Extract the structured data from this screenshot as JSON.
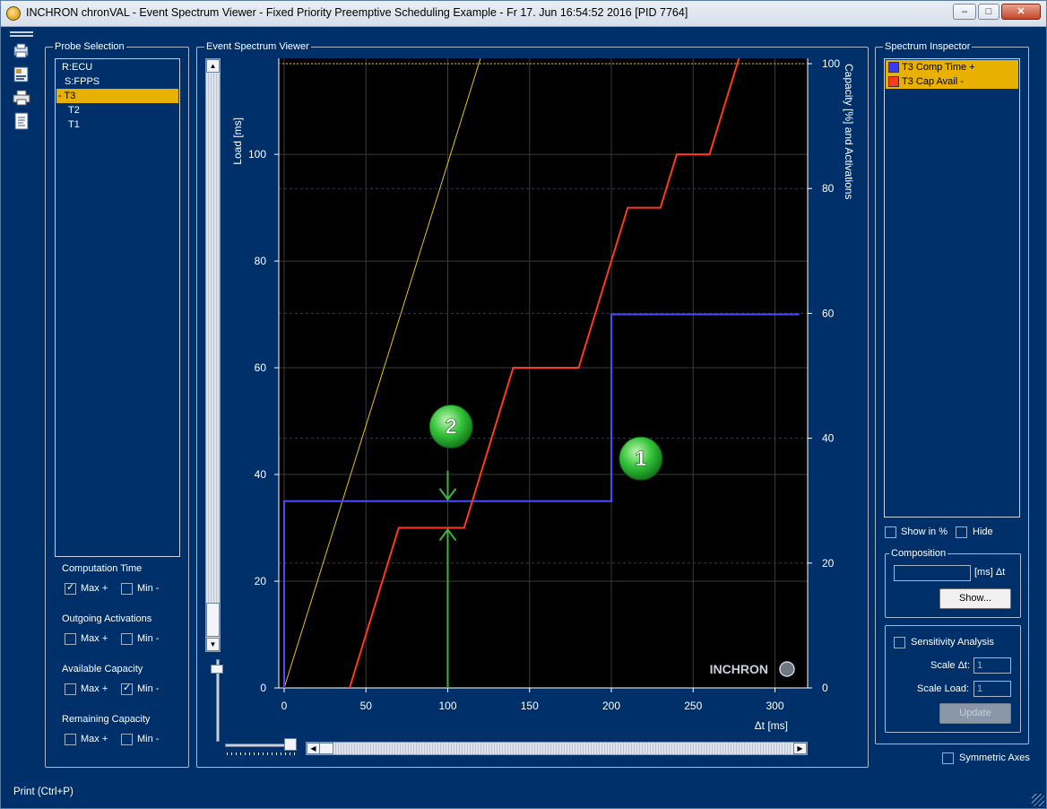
{
  "window": {
    "title": "INCHRON chronVAL - Event Spectrum Viewer - Fixed Priority Preemptive Scheduling Example - Fr 17. Jun 16:54:52 2016 [PID 7764]",
    "buttons": {
      "minimize": "–",
      "maximize": "□",
      "close": "✕"
    }
  },
  "toolbar": {
    "items": [
      {
        "icon": "print-preview-icon"
      },
      {
        "icon": "export-icon"
      },
      {
        "icon": "printer-icon"
      },
      {
        "icon": "report-icon"
      }
    ]
  },
  "probe_selection": {
    "title": "Probe Selection",
    "items": [
      {
        "label": "R:ECU",
        "selected": false
      },
      {
        "label": "S:FPPS",
        "selected": false
      },
      {
        "label": "-  T3",
        "selected": true
      },
      {
        "label": "T2",
        "selected": false
      },
      {
        "label": "T1",
        "selected": false
      }
    ],
    "sections": [
      {
        "label": "Computation Time",
        "max_label": "Max +",
        "min_label": "Min -",
        "max_checked": true,
        "min_checked": false
      },
      {
        "label": "Outgoing Activations",
        "max_label": "Max +",
        "min_label": "Min -",
        "max_checked": false,
        "min_checked": false
      },
      {
        "label": "Available Capacity",
        "max_label": "Max +",
        "min_label": "Min -",
        "max_checked": false,
        "min_checked": true
      },
      {
        "label": "Remaining Capacity",
        "max_label": "Max +",
        "min_label": "Min -",
        "max_checked": false,
        "min_checked": false
      }
    ]
  },
  "event_spectrum_viewer": {
    "title": "Event Spectrum Viewer",
    "logo": "INCHRON"
  },
  "chart_data": {
    "type": "line",
    "title": "",
    "xlabel": "Δt [ms]",
    "ylabel_left": "Load [ms]",
    "ylabel_right": "Capacity [%] and Activations",
    "xlim": [
      0,
      320
    ],
    "ylim_left": [
      0,
      118
    ],
    "ylim_right": [
      0,
      100
    ],
    "x_ticks": [
      0,
      50,
      100,
      150,
      200,
      250,
      300
    ],
    "y_left_ticks": [
      0,
      20,
      40,
      60,
      80,
      100
    ],
    "y_right_ticks": [
      0,
      20,
      40,
      60,
      80,
      100
    ],
    "grid": true,
    "series": [
      {
        "color": "#e8c020",
        "axis": "left",
        "x": [
          0,
          120
        ],
        "y": [
          0,
          118
        ]
      },
      {
        "color": "#4a4aff",
        "axis": "left",
        "x": [
          0,
          0,
          200,
          200,
          315
        ],
        "y": [
          0,
          35,
          35,
          70,
          70
        ]
      },
      {
        "color": "#ff3a1a",
        "axis": "left",
        "x": [
          40,
          70,
          110,
          140,
          180,
          210,
          230,
          240,
          260,
          280
        ],
        "y": [
          0,
          30,
          30,
          60,
          60,
          90,
          90,
          100,
          100,
          120
        ]
      }
    ],
    "reference_line_right": 100,
    "annotations": [
      {
        "label": "1",
        "x": 218,
        "y": 43
      },
      {
        "label": "2",
        "x": 102,
        "y": 49
      }
    ],
    "marker_x": 100,
    "marker_y_top": 35,
    "marker_y_bottom": 30
  },
  "spectrum_inspector": {
    "title": "Spectrum Inspector",
    "items": [
      {
        "label": "T3 Comp Time +",
        "swatch_color": "#3a3aff"
      },
      {
        "label": "T3 Cap Avail -",
        "swatch_color": "#ff3a1a"
      }
    ],
    "show_percent_label": "Show in %",
    "hide_label": "Hide",
    "composition": {
      "title": "Composition",
      "unit_label": "[ms] Δt",
      "show_button": "Show..."
    },
    "sensitivity": {
      "label": "Sensitivity Analysis",
      "scale_dt_label": "Scale Δt:",
      "scale_dt_value": "1",
      "scale_load_label": "Scale Load:",
      "scale_load_value": "1",
      "update_button": "Update"
    },
    "symmetric_axes_label": "Symmetric Axes"
  },
  "status": {
    "text": "Print (Ctrl+P)"
  }
}
